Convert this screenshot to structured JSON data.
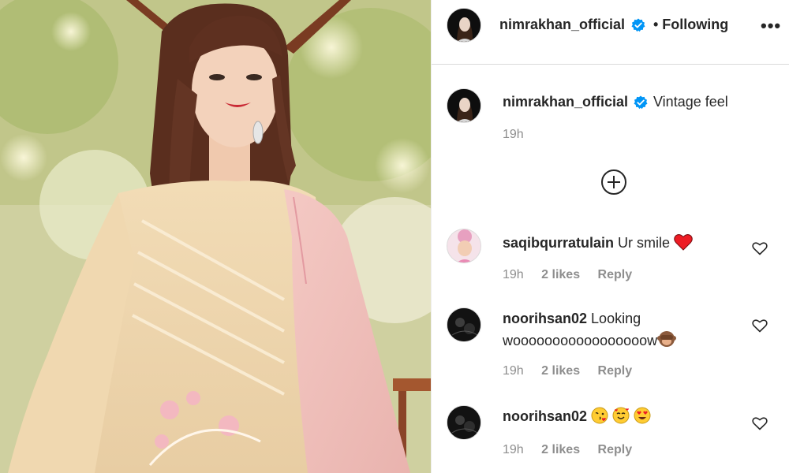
{
  "post": {
    "author": "nimrakhan_official",
    "follow_status": "• Following",
    "more_label": "•••",
    "caption_text": "Vintage feel",
    "caption_time": "19h",
    "image_alt": "woman in peach embroidered kurta with pink dupatta"
  },
  "comments": [
    {
      "user": "saqibqurratulain",
      "text": "Ur smile",
      "emojis": [
        "red-heart"
      ],
      "time": "19h",
      "likes": "2 likes",
      "reply": "Reply"
    },
    {
      "user": "noorihsan02",
      "text": "Looking wooooooooooooooooow",
      "emojis": [
        "see-no-evil-monkey"
      ],
      "time": "19h",
      "likes": "2 likes",
      "reply": "Reply"
    },
    {
      "user": "noorihsan02",
      "text": "",
      "emojis": [
        "face-blowing-kiss",
        "smiling-face-with-hearts",
        "heart-eyes"
      ],
      "time": "19h",
      "likes": "2 likes",
      "reply": "Reply"
    }
  ],
  "colors": {
    "verified": "#0095f6",
    "secondary_text": "#8e8e8e",
    "primary_text": "#262626",
    "heart_red": "#ed1c24"
  }
}
